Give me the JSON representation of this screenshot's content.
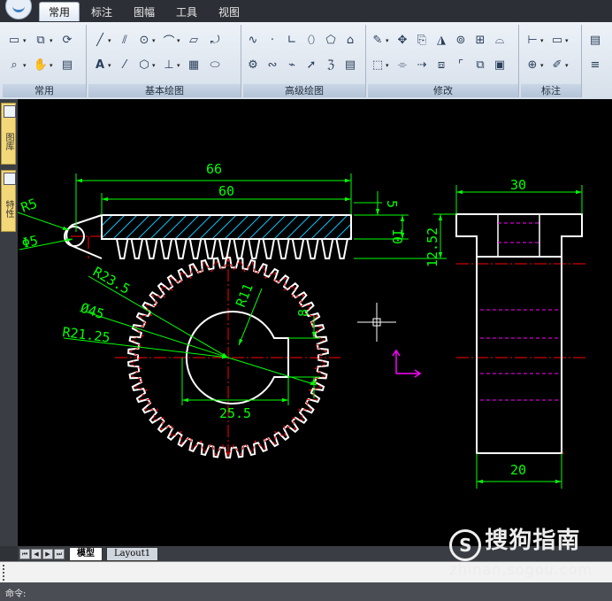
{
  "menu": {
    "tabs": [
      "常用",
      "标注",
      "图幅",
      "工具",
      "视图"
    ],
    "active_tab": "常用"
  },
  "ribbon": {
    "panels": [
      "常用",
      "基本绘图",
      "高级绘图",
      "修改",
      "标注"
    ]
  },
  "left_panel": {
    "tabs": [
      "图库",
      "特性"
    ]
  },
  "drawing": {
    "dims": {
      "d66": "66",
      "d60": "60",
      "d5": "5",
      "d10": "10",
      "d12_52": "12.52",
      "r5": "R5",
      "phi5": "Φ5",
      "r23_5": "R23.5",
      "phi45": "Ø45",
      "r21_25": "R21.25",
      "r11": "R11",
      "d8": "8",
      "d25_5": "25.5",
      "d30": "30",
      "d20": "20"
    },
    "colors": {
      "background": "#000000",
      "outline": "#ffffff",
      "dimension": "#00ff00",
      "center": "#ff0000",
      "hatch": "#00c8ff",
      "hidden": "#ff00ff",
      "ucs": "#ff00ff"
    },
    "gear_teeth": 50,
    "rack_teeth": 16
  },
  "layout_tabs": [
    "模型",
    "Layout1"
  ],
  "active_layout": "模型",
  "command": {
    "prompt": "命令:"
  },
  "watermark": {
    "brand": "搜狗指南",
    "url": "zhinan.sogou.com",
    "logo_letter": "S"
  }
}
